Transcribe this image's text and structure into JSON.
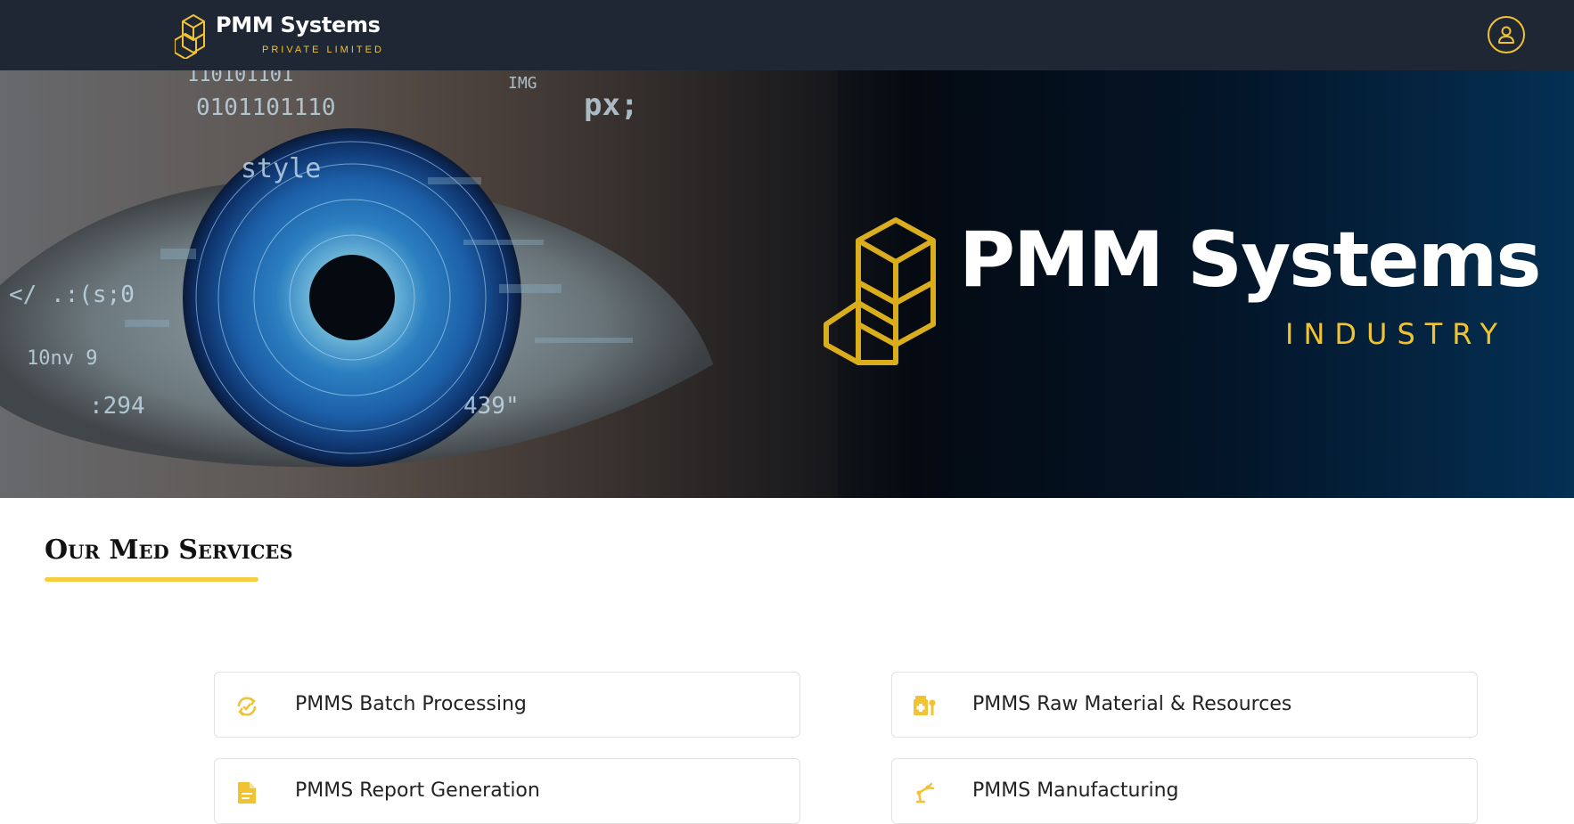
{
  "header": {
    "brand_name": "PMM Systems",
    "brand_sub": "PRIVATE LIMITED",
    "user_icon": "user-circle-icon"
  },
  "hero": {
    "title": "PMM Systems",
    "subtitle": "INDUSTRY",
    "image": "digital-eye-banner"
  },
  "section": {
    "title": "Our Med Services"
  },
  "services": [
    {
      "label": "PMMS Batch Processing",
      "icon": "refresh-check-icon"
    },
    {
      "label": "PMMS Raw Material & Resources",
      "icon": "medicine-box-icon"
    },
    {
      "label": "PMMS Report Generation",
      "icon": "document-report-icon"
    },
    {
      "label": "PMMS Manufacturing",
      "icon": "robot-arm-icon"
    }
  ],
  "colors": {
    "nav_bg": "#1f2735",
    "accent": "#f1c232",
    "underline": "#f5cf3f"
  }
}
